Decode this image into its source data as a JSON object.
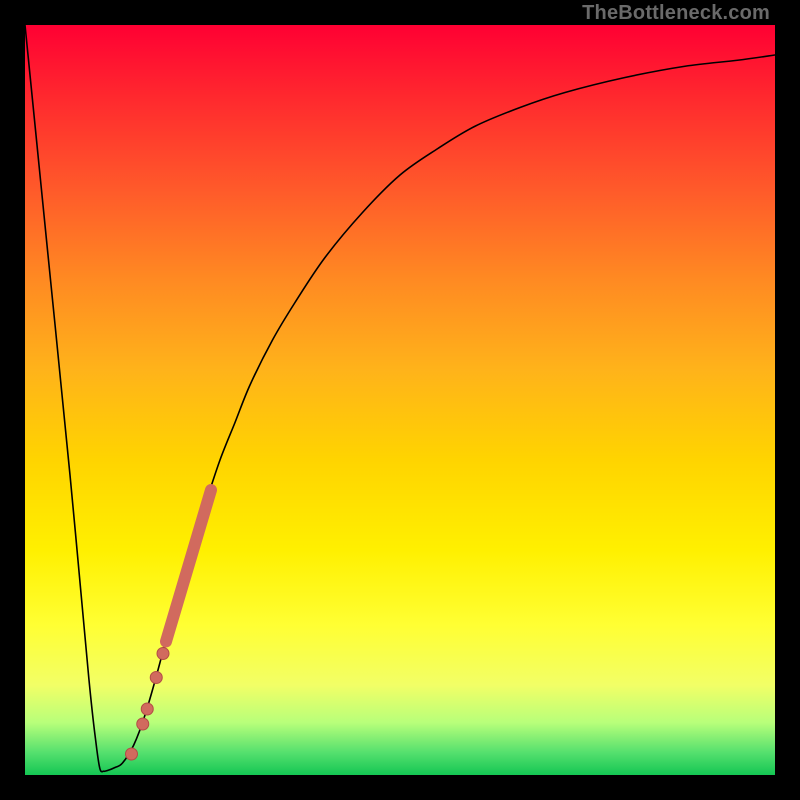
{
  "watermark": "TheBottleneck.com",
  "colors": {
    "curve": "#000000",
    "markers_fill": "#d16a5e",
    "markers_stroke": "#b34d46",
    "thick_segment": "#d16a5e"
  },
  "chart_data": {
    "type": "line",
    "title": "",
    "xlabel": "",
    "ylabel": "",
    "xlim": [
      0,
      100
    ],
    "ylim": [
      0,
      100
    ],
    "series": [
      {
        "name": "bottleneck-curve",
        "x": [
          0,
          3,
          6,
          8.5,
          9.5,
          10,
          10.5,
          11,
          12,
          13,
          14.5,
          16,
          18,
          20,
          22,
          24,
          26,
          28,
          30,
          33,
          36,
          40,
          45,
          50,
          55,
          60,
          66,
          72,
          80,
          88,
          95,
          100
        ],
        "values": [
          100,
          70,
          40,
          13,
          4,
          0.8,
          0.5,
          0.6,
          1.0,
          1.6,
          4,
          8,
          15,
          23,
          30,
          36,
          42,
          47,
          52,
          58,
          63,
          69,
          75,
          80,
          83.5,
          86.5,
          89,
          91,
          93,
          94.5,
          95.3,
          96
        ]
      }
    ],
    "markers": [
      {
        "x": 14.2,
        "y": 2.8
      },
      {
        "x": 15.7,
        "y": 6.8
      },
      {
        "x": 16.3,
        "y": 8.8
      },
      {
        "x": 17.5,
        "y": 13.0
      },
      {
        "x": 18.4,
        "y": 16.2
      }
    ],
    "thick_segment": {
      "x": [
        18.8,
        24.8
      ],
      "values": [
        17.8,
        38.0
      ]
    },
    "grid": false,
    "legend": false
  }
}
